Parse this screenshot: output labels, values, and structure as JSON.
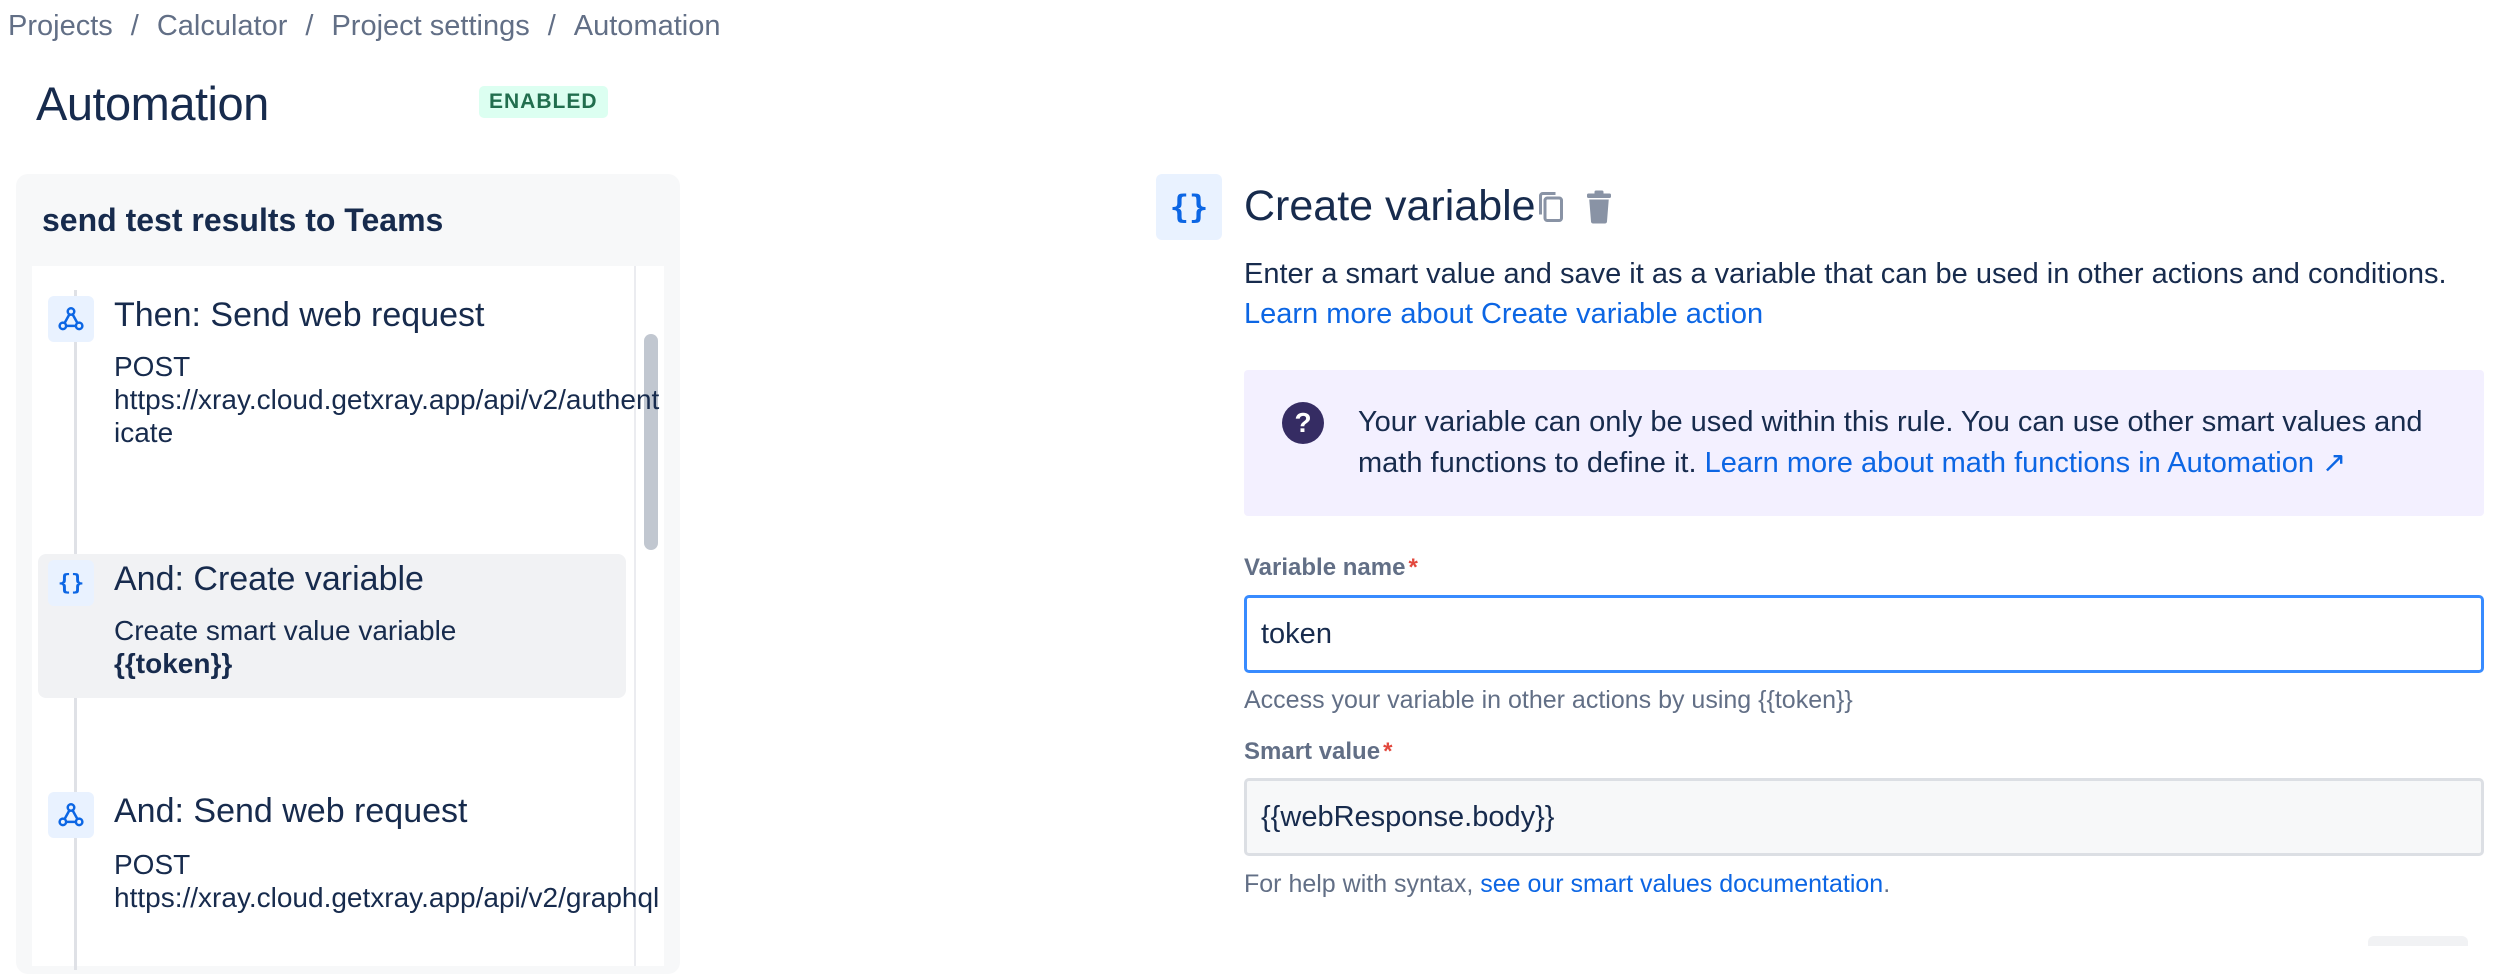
{
  "breadcrumb": {
    "items": [
      "Projects",
      "Calculator",
      "Project settings",
      "Automation"
    ],
    "separator": "/"
  },
  "page": {
    "title": "Automation",
    "status_badge": "ENABLED"
  },
  "rule": {
    "name": "send test results to Teams",
    "steps": [
      {
        "icon": "webhook-icon",
        "title": "Then: Send web request",
        "line1": "POST",
        "line2": "https://xray.cloud.getxray.app/api/v2/authenticate"
      },
      {
        "icon": "curly-braces-icon",
        "title": "And: Create variable",
        "line1": "Create smart value variable",
        "line2": "{{token}}"
      },
      {
        "icon": "webhook-icon",
        "title": "And: Send web request",
        "line1": "POST",
        "line2": "https://xray.cloud.getxray.app/api/v2/graphql"
      }
    ]
  },
  "config": {
    "icon_glyph": "{}",
    "title": "Create variable",
    "description": "Enter a smart value and save it as a variable that can be used in other actions and conditions.",
    "learn_link": "Learn more about Create variable action",
    "info": {
      "icon_glyph": "?",
      "text": "Your variable can only be used within this rule. You can use other smart values and math functions to define it. ",
      "link": "Learn more about math functions in Automation ↗"
    },
    "variable_name": {
      "label": "Variable name",
      "required_mark": "*",
      "value": "token",
      "help": "Access your variable in other actions by using {{token}}"
    },
    "smart_value": {
      "label": "Smart value",
      "required_mark": "*",
      "value": "{{webResponse.body}}",
      "help_prefix": "For help with syntax, ",
      "help_link": "see our smart values documentation",
      "help_suffix": "."
    }
  },
  "colors": {
    "accent": "#0c66e4",
    "badge_bg": "#dcfff1",
    "badge_text": "#216e4e",
    "info_bg": "#f3f0ff",
    "info_icon": "#352c63",
    "required": "#e2483d",
    "focus_border": "#388bff"
  }
}
